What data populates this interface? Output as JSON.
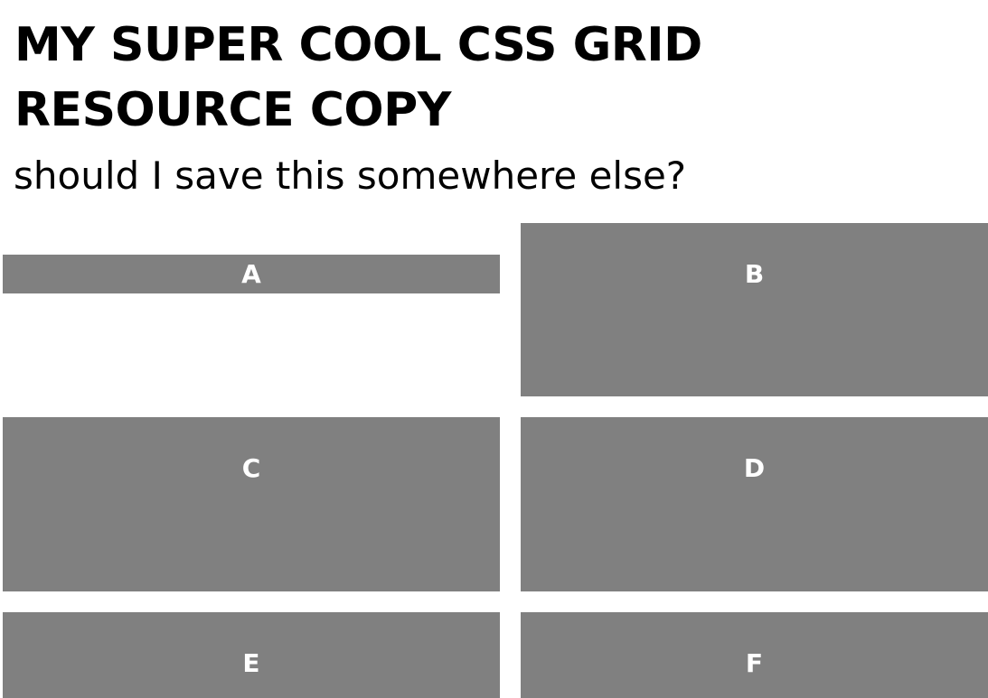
{
  "header": {
    "title": "MY SUPER COOL CSS GRID RESOURCE COPY",
    "subtitle": "should I save this somewhere else?"
  },
  "grid": {
    "items": [
      {
        "label": "A"
      },
      {
        "label": "B"
      },
      {
        "label": "C"
      },
      {
        "label": "D"
      },
      {
        "label": "E"
      },
      {
        "label": "F"
      }
    ]
  },
  "colors": {
    "item_background": "#808080",
    "item_text": "#ffffff",
    "page_background": "#ffffff",
    "text": "#000000"
  }
}
